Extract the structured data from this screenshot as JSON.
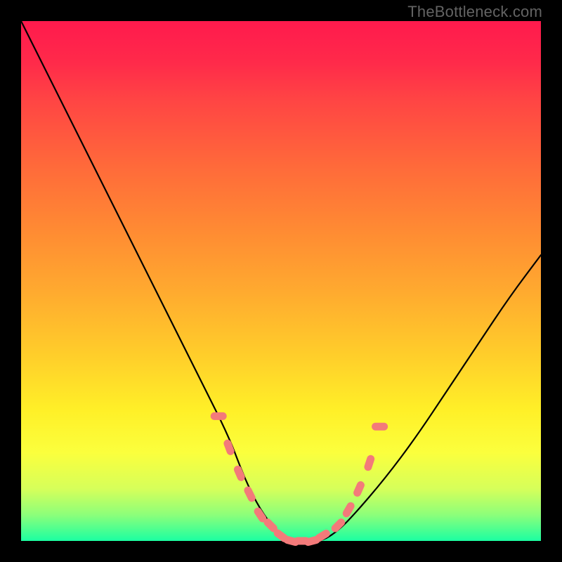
{
  "attribution": "TheBottleneck.com",
  "chart_data": {
    "type": "line",
    "title": "",
    "xlabel": "",
    "ylabel": "",
    "xlim": [
      0,
      100
    ],
    "ylim": [
      0,
      100
    ],
    "series": [
      {
        "name": "bottleneck-curve",
        "x": [
          0,
          5,
          10,
          15,
          20,
          25,
          30,
          35,
          40,
          43,
          46,
          49,
          52,
          55,
          58,
          61,
          64,
          70,
          76,
          82,
          88,
          94,
          100
        ],
        "values": [
          100,
          90,
          80,
          70,
          60,
          50,
          40,
          30,
          20,
          12,
          6,
          2,
          0,
          0,
          0,
          2,
          5,
          12,
          20,
          29,
          38,
          47,
          55
        ]
      },
      {
        "name": "markers",
        "x": [
          38,
          40,
          42,
          44,
          46,
          48,
          50,
          52,
          54,
          56,
          58,
          61,
          63,
          65,
          67,
          69
        ],
        "values": [
          24,
          18,
          13,
          9,
          5,
          3,
          1,
          0,
          0,
          0,
          1,
          3,
          6,
          10,
          15,
          22
        ]
      }
    ]
  },
  "colors": {
    "curve": "#000000",
    "marker": "#f37a7a",
    "attribution": "#636363"
  }
}
